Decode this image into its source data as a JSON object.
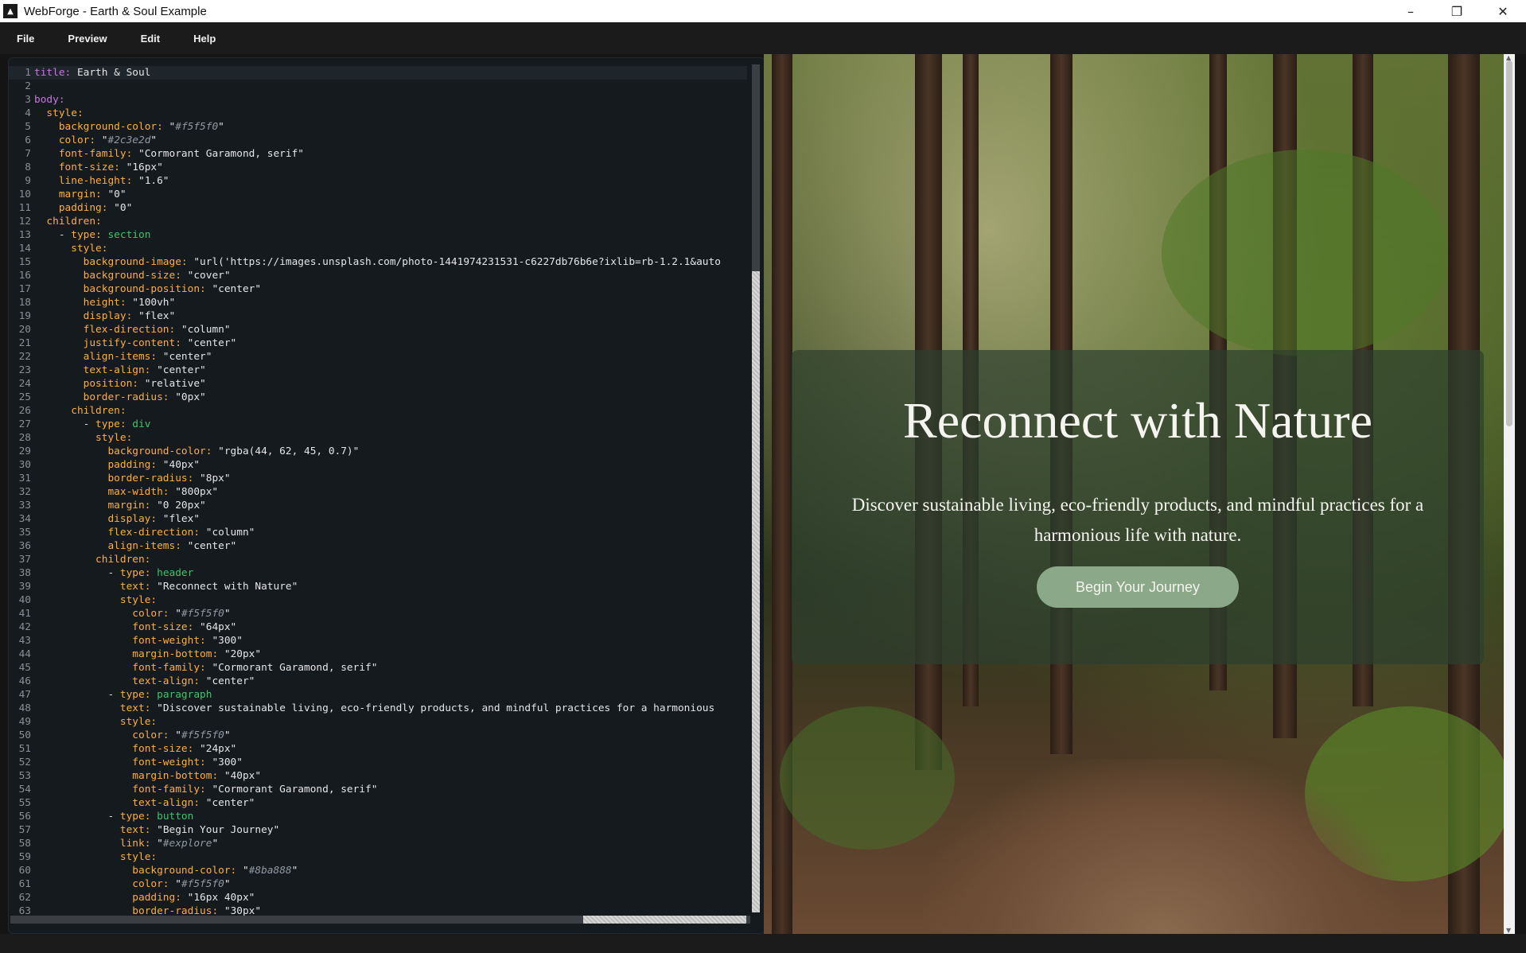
{
  "window": {
    "title": "WebForge - Earth & Soul Example",
    "icon": "webforge-logo-icon",
    "controls": [
      "minimize-icon",
      "restore-icon",
      "close-icon"
    ]
  },
  "menu": [
    "File",
    "Preview",
    "Edit",
    "Help"
  ],
  "editor": {
    "active_line": 1,
    "lines": [
      {
        "n": "1",
        "parts": [
          [
            "k0",
            "title:"
          ],
          [
            "s",
            " Earth & Soul"
          ]
        ]
      },
      {
        "n": "2",
        "parts": []
      },
      {
        "n": "3",
        "parts": [
          [
            "k0",
            "body:"
          ]
        ]
      },
      {
        "n": "4",
        "parts": [
          [
            "p",
            "  "
          ],
          [
            "k",
            "style:"
          ]
        ]
      },
      {
        "n": "5",
        "parts": [
          [
            "p",
            "    "
          ],
          [
            "k",
            "background-color:"
          ],
          [
            "s",
            " \""
          ],
          [
            "sh",
            "#f5f5f0"
          ],
          [
            "s",
            "\""
          ]
        ]
      },
      {
        "n": "6",
        "parts": [
          [
            "p",
            "    "
          ],
          [
            "k",
            "color:"
          ],
          [
            "s",
            " \""
          ],
          [
            "sh",
            "#2c3e2d"
          ],
          [
            "s",
            "\""
          ]
        ]
      },
      {
        "n": "7",
        "parts": [
          [
            "p",
            "    "
          ],
          [
            "k",
            "font-family:"
          ],
          [
            "s",
            " \"Cormorant Garamond, serif\""
          ]
        ]
      },
      {
        "n": "8",
        "parts": [
          [
            "p",
            "    "
          ],
          [
            "k",
            "font-size:"
          ],
          [
            "s",
            " \"16px\""
          ]
        ]
      },
      {
        "n": "9",
        "parts": [
          [
            "p",
            "    "
          ],
          [
            "k",
            "line-height:"
          ],
          [
            "s",
            " \"1.6\""
          ]
        ]
      },
      {
        "n": "10",
        "parts": [
          [
            "p",
            "    "
          ],
          [
            "k",
            "margin:"
          ],
          [
            "s",
            " \"0\""
          ]
        ]
      },
      {
        "n": "11",
        "parts": [
          [
            "p",
            "    "
          ],
          [
            "k",
            "padding:"
          ],
          [
            "s",
            " \"0\""
          ]
        ]
      },
      {
        "n": "12",
        "parts": [
          [
            "p",
            "  "
          ],
          [
            "k",
            "children:"
          ]
        ]
      },
      {
        "n": "13",
        "parts": [
          [
            "p",
            "    - "
          ],
          [
            "k",
            "type:"
          ],
          [
            "v",
            " section"
          ]
        ]
      },
      {
        "n": "14",
        "parts": [
          [
            "p",
            "      "
          ],
          [
            "k",
            "style:"
          ]
        ]
      },
      {
        "n": "15",
        "parts": [
          [
            "p",
            "        "
          ],
          [
            "k",
            "background-image:"
          ],
          [
            "s",
            " \"url('https://images.unsplash.com/photo-1441974231531-c6227db76b6e?ixlib=rb-1.2.1&auto"
          ]
        ]
      },
      {
        "n": "16",
        "parts": [
          [
            "p",
            "        "
          ],
          [
            "k",
            "background-size:"
          ],
          [
            "s",
            " \"cover\""
          ]
        ]
      },
      {
        "n": "17",
        "parts": [
          [
            "p",
            "        "
          ],
          [
            "k",
            "background-position:"
          ],
          [
            "s",
            " \"center\""
          ]
        ]
      },
      {
        "n": "18",
        "parts": [
          [
            "p",
            "        "
          ],
          [
            "k",
            "height:"
          ],
          [
            "s",
            " \"100vh\""
          ]
        ]
      },
      {
        "n": "19",
        "parts": [
          [
            "p",
            "        "
          ],
          [
            "k",
            "display:"
          ],
          [
            "s",
            " \"flex\""
          ]
        ]
      },
      {
        "n": "20",
        "parts": [
          [
            "p",
            "        "
          ],
          [
            "k",
            "flex-direction:"
          ],
          [
            "s",
            " \"column\""
          ]
        ]
      },
      {
        "n": "21",
        "parts": [
          [
            "p",
            "        "
          ],
          [
            "k",
            "justify-content:"
          ],
          [
            "s",
            " \"center\""
          ]
        ]
      },
      {
        "n": "22",
        "parts": [
          [
            "p",
            "        "
          ],
          [
            "k",
            "align-items:"
          ],
          [
            "s",
            " \"center\""
          ]
        ]
      },
      {
        "n": "23",
        "parts": [
          [
            "p",
            "        "
          ],
          [
            "k",
            "text-align:"
          ],
          [
            "s",
            " \"center\""
          ]
        ]
      },
      {
        "n": "24",
        "parts": [
          [
            "p",
            "        "
          ],
          [
            "k",
            "position:"
          ],
          [
            "s",
            " \"relative\""
          ]
        ]
      },
      {
        "n": "25",
        "parts": [
          [
            "p",
            "        "
          ],
          [
            "k",
            "border-radius:"
          ],
          [
            "s",
            " \"0px\""
          ]
        ]
      },
      {
        "n": "26",
        "parts": [
          [
            "p",
            "      "
          ],
          [
            "k",
            "children:"
          ]
        ]
      },
      {
        "n": "27",
        "parts": [
          [
            "p",
            "        - "
          ],
          [
            "k",
            "type:"
          ],
          [
            "v",
            " div"
          ]
        ]
      },
      {
        "n": "28",
        "parts": [
          [
            "p",
            "          "
          ],
          [
            "k",
            "style:"
          ]
        ]
      },
      {
        "n": "29",
        "parts": [
          [
            "p",
            "            "
          ],
          [
            "k",
            "background-color:"
          ],
          [
            "s",
            " \"rgba(44, 62, 45, 0.7)\""
          ]
        ]
      },
      {
        "n": "30",
        "parts": [
          [
            "p",
            "            "
          ],
          [
            "k",
            "padding:"
          ],
          [
            "s",
            " \"40px\""
          ]
        ]
      },
      {
        "n": "31",
        "parts": [
          [
            "p",
            "            "
          ],
          [
            "k",
            "border-radius:"
          ],
          [
            "s",
            " \"8px\""
          ]
        ]
      },
      {
        "n": "32",
        "parts": [
          [
            "p",
            "            "
          ],
          [
            "k",
            "max-width:"
          ],
          [
            "s",
            " \"800px\""
          ]
        ]
      },
      {
        "n": "33",
        "parts": [
          [
            "p",
            "            "
          ],
          [
            "k",
            "margin:"
          ],
          [
            "s",
            " \"0 20px\""
          ]
        ]
      },
      {
        "n": "34",
        "parts": [
          [
            "p",
            "            "
          ],
          [
            "k",
            "display:"
          ],
          [
            "s",
            " \"flex\""
          ]
        ]
      },
      {
        "n": "35",
        "parts": [
          [
            "p",
            "            "
          ],
          [
            "k",
            "flex-direction:"
          ],
          [
            "s",
            " \"column\""
          ]
        ]
      },
      {
        "n": "36",
        "parts": [
          [
            "p",
            "            "
          ],
          [
            "k",
            "align-items:"
          ],
          [
            "s",
            " \"center\""
          ]
        ]
      },
      {
        "n": "37",
        "parts": [
          [
            "p",
            "          "
          ],
          [
            "k",
            "children:"
          ]
        ]
      },
      {
        "n": "38",
        "parts": [
          [
            "p",
            "            - "
          ],
          [
            "k",
            "type:"
          ],
          [
            "v",
            " header"
          ]
        ]
      },
      {
        "n": "39",
        "parts": [
          [
            "p",
            "              "
          ],
          [
            "k",
            "text:"
          ],
          [
            "s",
            " \"Reconnect with Nature\""
          ]
        ]
      },
      {
        "n": "40",
        "parts": [
          [
            "p",
            "              "
          ],
          [
            "k",
            "style:"
          ]
        ]
      },
      {
        "n": "41",
        "parts": [
          [
            "p",
            "                "
          ],
          [
            "k",
            "color:"
          ],
          [
            "s",
            " \""
          ],
          [
            "sh",
            "#f5f5f0"
          ],
          [
            "s",
            "\""
          ]
        ]
      },
      {
        "n": "42",
        "parts": [
          [
            "p",
            "                "
          ],
          [
            "k",
            "font-size:"
          ],
          [
            "s",
            " \"64px\""
          ]
        ]
      },
      {
        "n": "43",
        "parts": [
          [
            "p",
            "                "
          ],
          [
            "k",
            "font-weight:"
          ],
          [
            "s",
            " \"300\""
          ]
        ]
      },
      {
        "n": "44",
        "parts": [
          [
            "p",
            "                "
          ],
          [
            "k",
            "margin-bottom:"
          ],
          [
            "s",
            " \"20px\""
          ]
        ]
      },
      {
        "n": "45",
        "parts": [
          [
            "p",
            "                "
          ],
          [
            "k",
            "font-family:"
          ],
          [
            "s",
            " \"Cormorant Garamond, serif\""
          ]
        ]
      },
      {
        "n": "46",
        "parts": [
          [
            "p",
            "                "
          ],
          [
            "k",
            "text-align:"
          ],
          [
            "s",
            " \"center\""
          ]
        ]
      },
      {
        "n": "47",
        "parts": [
          [
            "p",
            "            - "
          ],
          [
            "k",
            "type:"
          ],
          [
            "v",
            " paragraph"
          ]
        ]
      },
      {
        "n": "48",
        "parts": [
          [
            "p",
            "              "
          ],
          [
            "k",
            "text:"
          ],
          [
            "s",
            " \"Discover sustainable living, eco-friendly products, and mindful practices for a harmonious"
          ]
        ]
      },
      {
        "n": "49",
        "parts": [
          [
            "p",
            "              "
          ],
          [
            "k",
            "style:"
          ]
        ]
      },
      {
        "n": "50",
        "parts": [
          [
            "p",
            "                "
          ],
          [
            "k",
            "color:"
          ],
          [
            "s",
            " \""
          ],
          [
            "sh",
            "#f5f5f0"
          ],
          [
            "s",
            "\""
          ]
        ]
      },
      {
        "n": "51",
        "parts": [
          [
            "p",
            "                "
          ],
          [
            "k",
            "font-size:"
          ],
          [
            "s",
            " \"24px\""
          ]
        ]
      },
      {
        "n": "52",
        "parts": [
          [
            "p",
            "                "
          ],
          [
            "k",
            "font-weight:"
          ],
          [
            "s",
            " \"300\""
          ]
        ]
      },
      {
        "n": "53",
        "parts": [
          [
            "p",
            "                "
          ],
          [
            "k",
            "margin-bottom:"
          ],
          [
            "s",
            " \"40px\""
          ]
        ]
      },
      {
        "n": "54",
        "parts": [
          [
            "p",
            "                "
          ],
          [
            "k",
            "font-family:"
          ],
          [
            "s",
            " \"Cormorant Garamond, serif\""
          ]
        ]
      },
      {
        "n": "55",
        "parts": [
          [
            "p",
            "                "
          ],
          [
            "k",
            "text-align:"
          ],
          [
            "s",
            " \"center\""
          ]
        ]
      },
      {
        "n": "56",
        "parts": [
          [
            "p",
            "            - "
          ],
          [
            "k",
            "type:"
          ],
          [
            "v",
            " button"
          ]
        ]
      },
      {
        "n": "57",
        "parts": [
          [
            "p",
            "              "
          ],
          [
            "k",
            "text:"
          ],
          [
            "s",
            " \"Begin Your Journey\""
          ]
        ]
      },
      {
        "n": "58",
        "parts": [
          [
            "p",
            "              "
          ],
          [
            "k",
            "link:"
          ],
          [
            "s",
            " \""
          ],
          [
            "sh",
            "#explore"
          ],
          [
            "s",
            "\""
          ]
        ]
      },
      {
        "n": "59",
        "parts": [
          [
            "p",
            "              "
          ],
          [
            "k",
            "style:"
          ]
        ]
      },
      {
        "n": "60",
        "parts": [
          [
            "p",
            "                "
          ],
          [
            "k",
            "background-color:"
          ],
          [
            "s",
            " \""
          ],
          [
            "sh",
            "#8ba888"
          ],
          [
            "s",
            "\""
          ]
        ]
      },
      {
        "n": "61",
        "parts": [
          [
            "p",
            "                "
          ],
          [
            "k",
            "color:"
          ],
          [
            "s",
            " \""
          ],
          [
            "sh",
            "#f5f5f0"
          ],
          [
            "s",
            "\""
          ]
        ]
      },
      {
        "n": "62",
        "parts": [
          [
            "p",
            "                "
          ],
          [
            "k",
            "padding:"
          ],
          [
            "s",
            " \"16px 40px\""
          ]
        ]
      },
      {
        "n": "63",
        "parts": [
          [
            "p",
            "                "
          ],
          [
            "k",
            "border-radius:"
          ],
          [
            "s",
            " \"30px\""
          ]
        ]
      }
    ]
  },
  "preview": {
    "hero_title": "Reconnect with Nature",
    "hero_text": "Discover sustainable living, eco-friendly products, and mindful practices for a harmonious life with nature.",
    "hero_button": "Begin Your Journey",
    "card_color": "#2c3e2d",
    "button_color": "#8ba888",
    "text_color": "#f5f5f0"
  }
}
